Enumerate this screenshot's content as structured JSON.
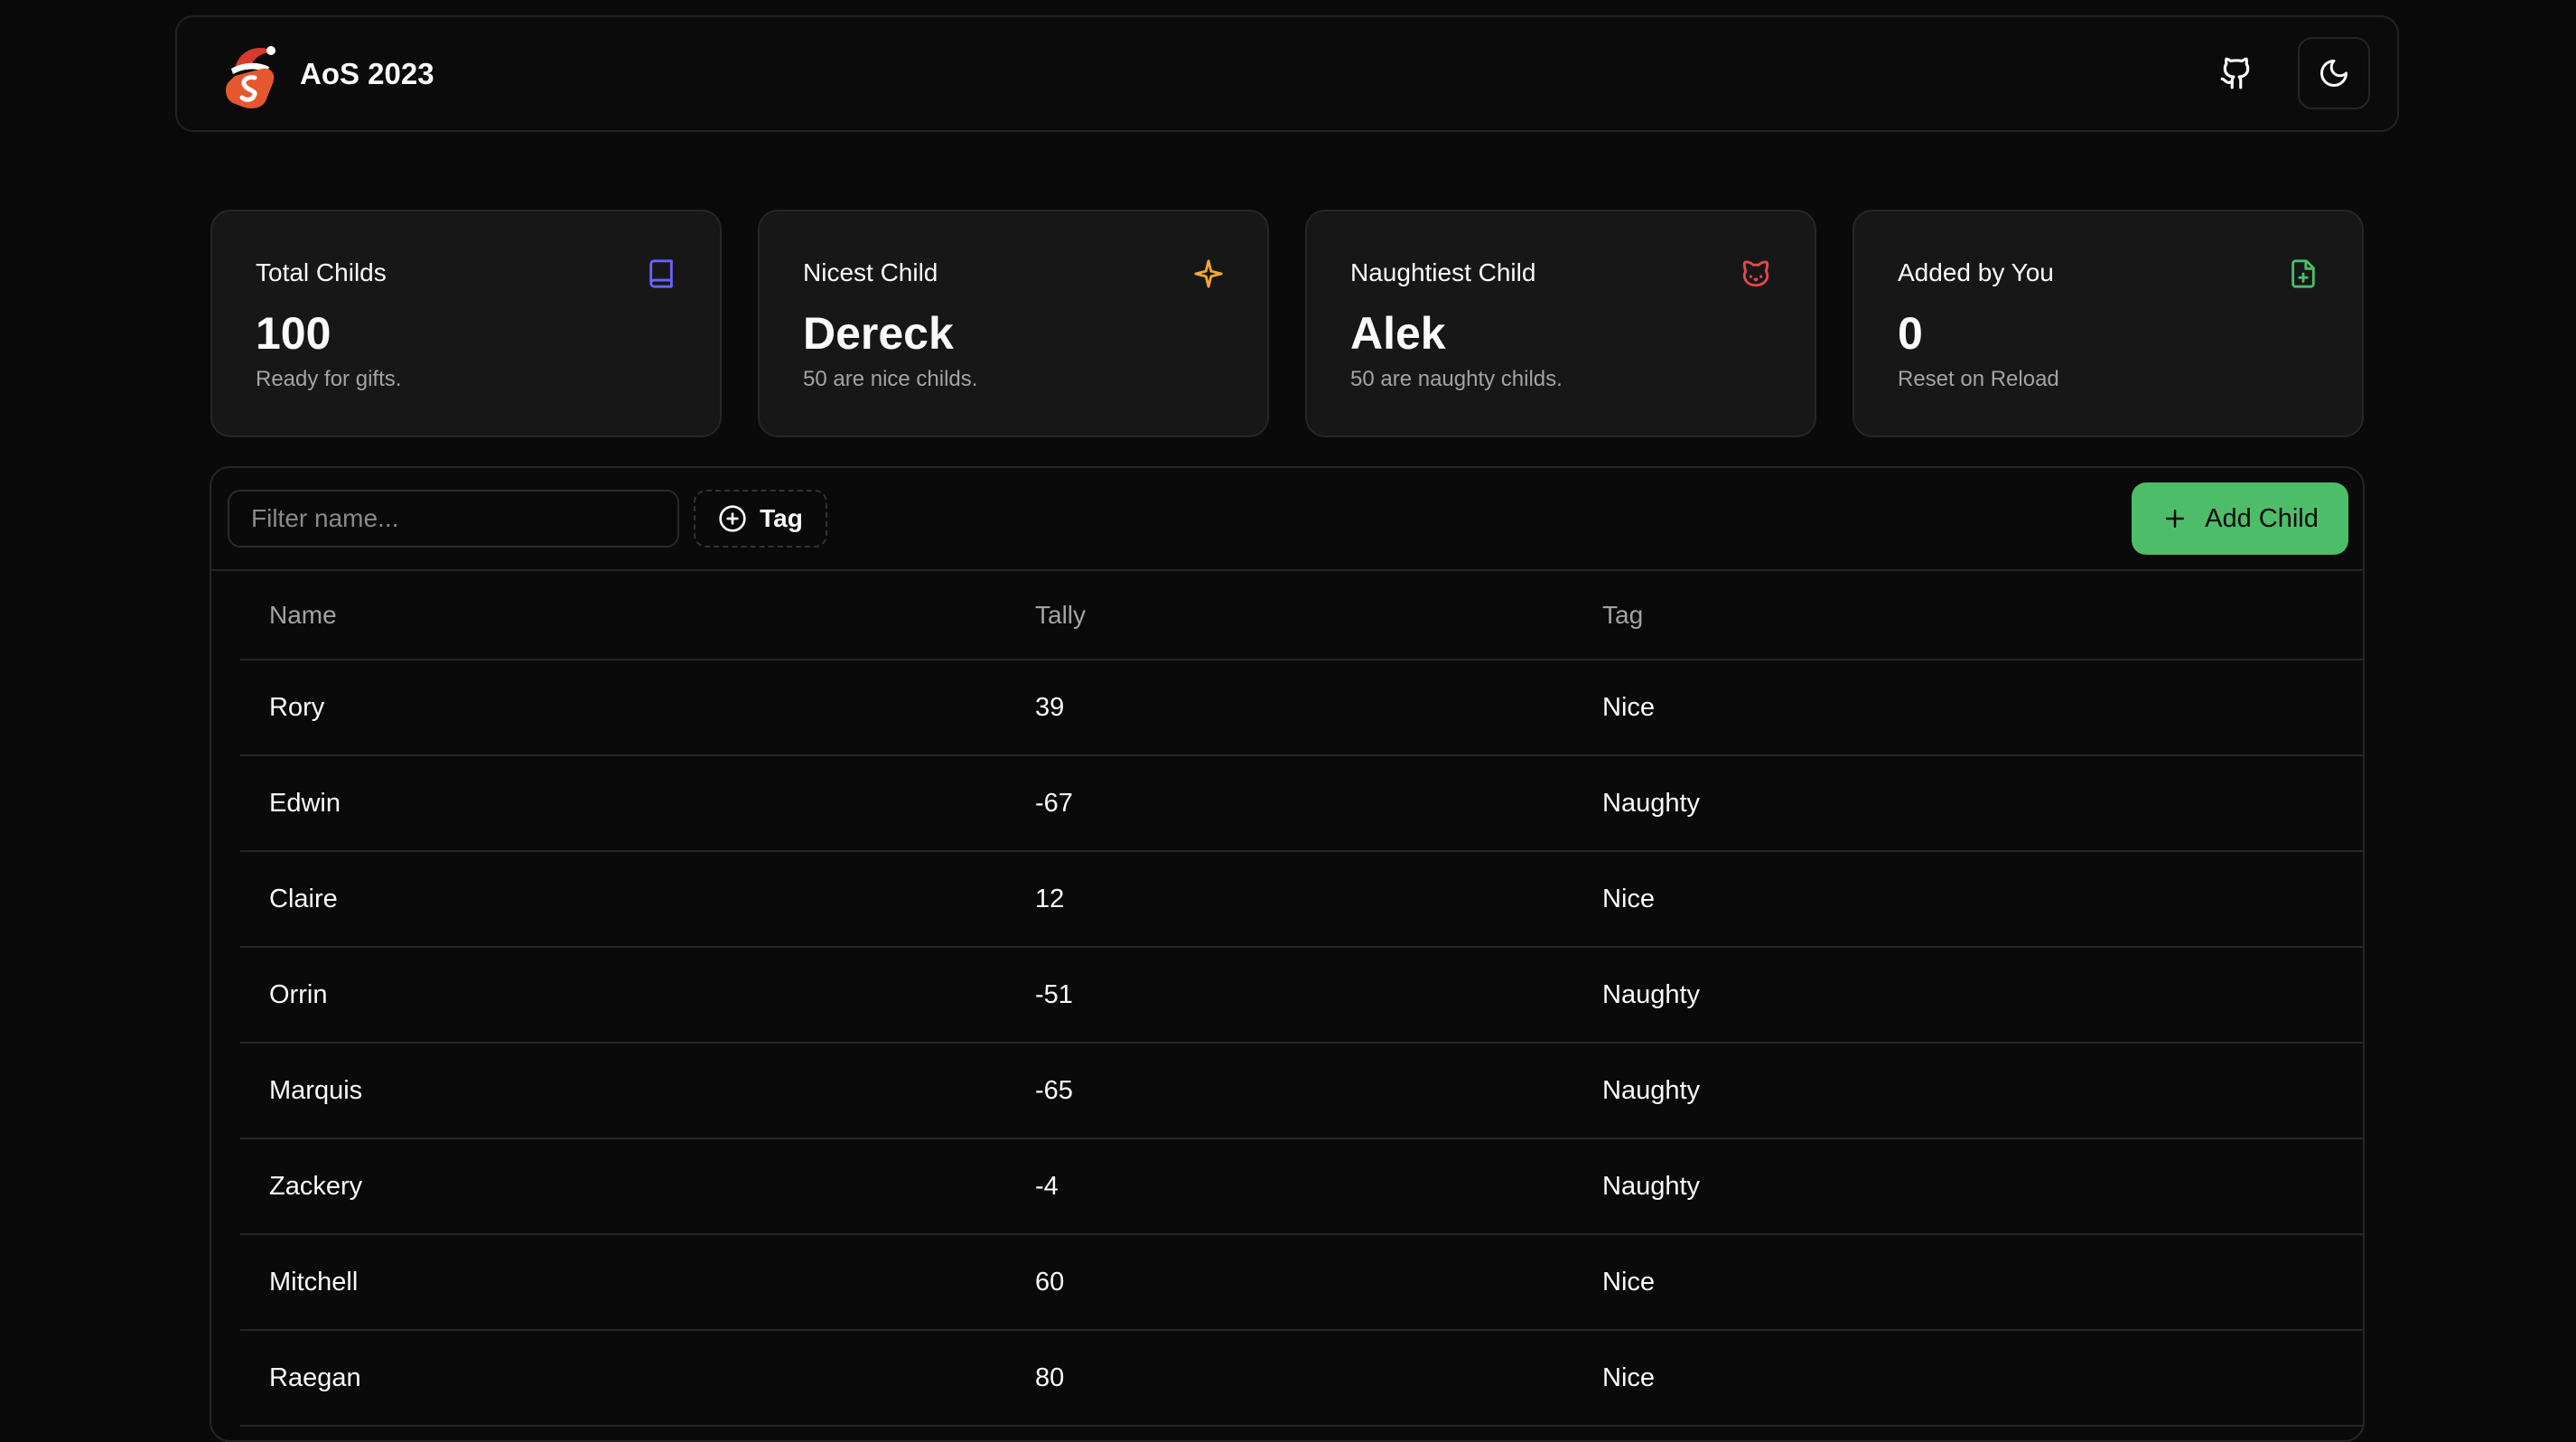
{
  "app": {
    "title": "AoS 2023"
  },
  "header": {
    "github_icon": "github-icon",
    "theme_icon": "moon-icon"
  },
  "stats": [
    {
      "title": "Total Childs",
      "value": "100",
      "sub": "Ready for gifts.",
      "icon": "book-icon",
      "color": "#6b63ff"
    },
    {
      "title": "Nicest Child",
      "value": "Dereck",
      "sub": "50 are nice childs.",
      "icon": "sparkle-icon",
      "color": "#f0a935"
    },
    {
      "title": "Naughtiest Child",
      "value": "Alek",
      "sub": "50 are naughty childs.",
      "icon": "cat-icon",
      "color": "#e5484d"
    },
    {
      "title": "Added by You",
      "value": "0",
      "sub": "Reset on Reload",
      "icon": "file-plus-icon",
      "color": "#4ebd6a"
    }
  ],
  "toolbar": {
    "filter_placeholder": "Filter name...",
    "tag_label": "Tag",
    "add_label": "Add Child",
    "add_color": "#4ebd6a"
  },
  "table": {
    "columns": [
      "Name",
      "Tally",
      "Tag"
    ],
    "rows": [
      {
        "name": "Rory",
        "tally": "39",
        "tag": "Nice"
      },
      {
        "name": "Edwin",
        "tally": "-67",
        "tag": "Naughty"
      },
      {
        "name": "Claire",
        "tally": "12",
        "tag": "Nice"
      },
      {
        "name": "Orrin",
        "tally": "-51",
        "tag": "Naughty"
      },
      {
        "name": "Marquis",
        "tally": "-65",
        "tag": "Naughty"
      },
      {
        "name": "Zackery",
        "tally": "-4",
        "tag": "Naughty"
      },
      {
        "name": "Mitchell",
        "tally": "60",
        "tag": "Nice"
      },
      {
        "name": "Raegan",
        "tally": "80",
        "tag": "Nice"
      }
    ]
  }
}
